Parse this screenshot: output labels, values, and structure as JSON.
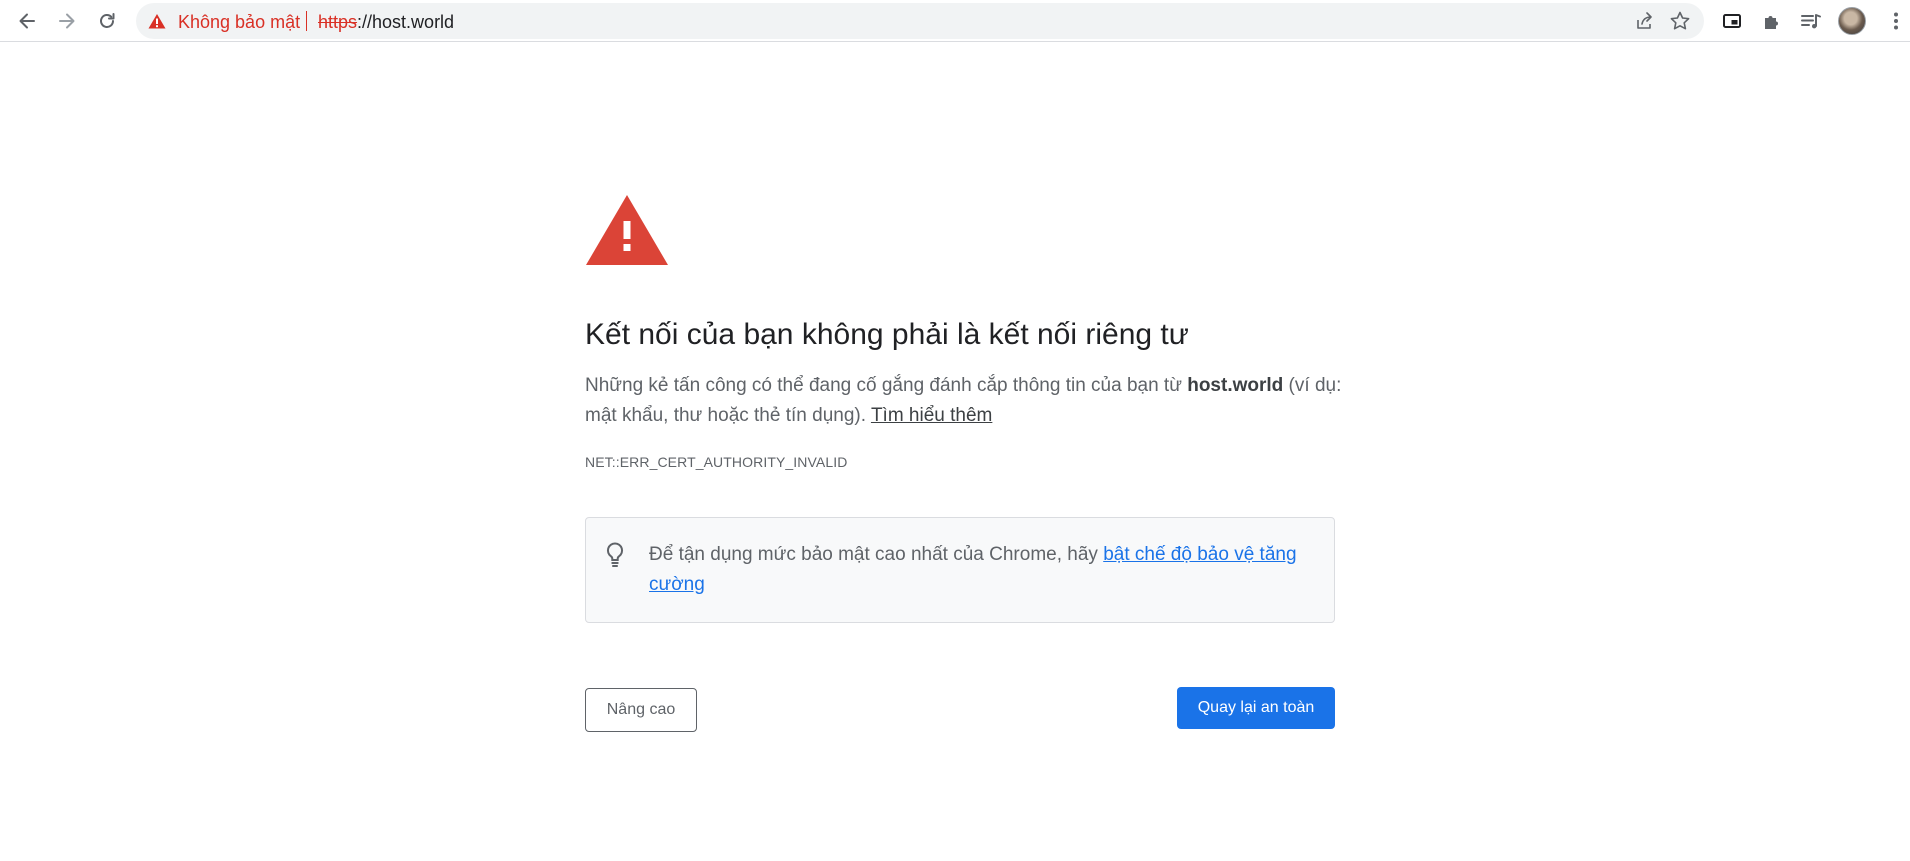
{
  "browser": {
    "security_label": "Không bảo mật",
    "url_scheme": "https",
    "url_rest": "://host.world",
    "icons": [
      "back-arrow-icon",
      "forward-arrow-icon",
      "reload-icon",
      "warning-triangle-icon",
      "share-icon",
      "star-icon",
      "picture-in-picture-icon",
      "puzzle-extensions-icon",
      "media-playlist-icon",
      "profile-avatar",
      "more-vertical-icon"
    ]
  },
  "page": {
    "heading": "Kết nối của bạn không phải là kết nối riêng tư",
    "explanation_prefix": "Những kẻ tấn công có thể đang cố gắng đánh cắp thông tin của bạn từ ",
    "explanation_host": "host.world",
    "explanation_suffix": " (ví dụ: mật khẩu, thư hoặc thẻ tín dụng). ",
    "learn_more": "Tìm hiểu thêm",
    "error_code": "NET::ERR_CERT_AUTHORITY_INVALID",
    "tip_prefix": "Để tận dụng mức bảo mật cao nhất của Chrome, hãy ",
    "tip_link": "bật chế độ bảo vệ tăng cường",
    "advanced_button": "Nâng cao",
    "back_button": "Quay lại an toàn"
  },
  "colors": {
    "warning_red": "#d93025",
    "primary_blue": "#1a73e8",
    "text_gray": "#5f6368",
    "tip_background": "#f8f9fa"
  }
}
